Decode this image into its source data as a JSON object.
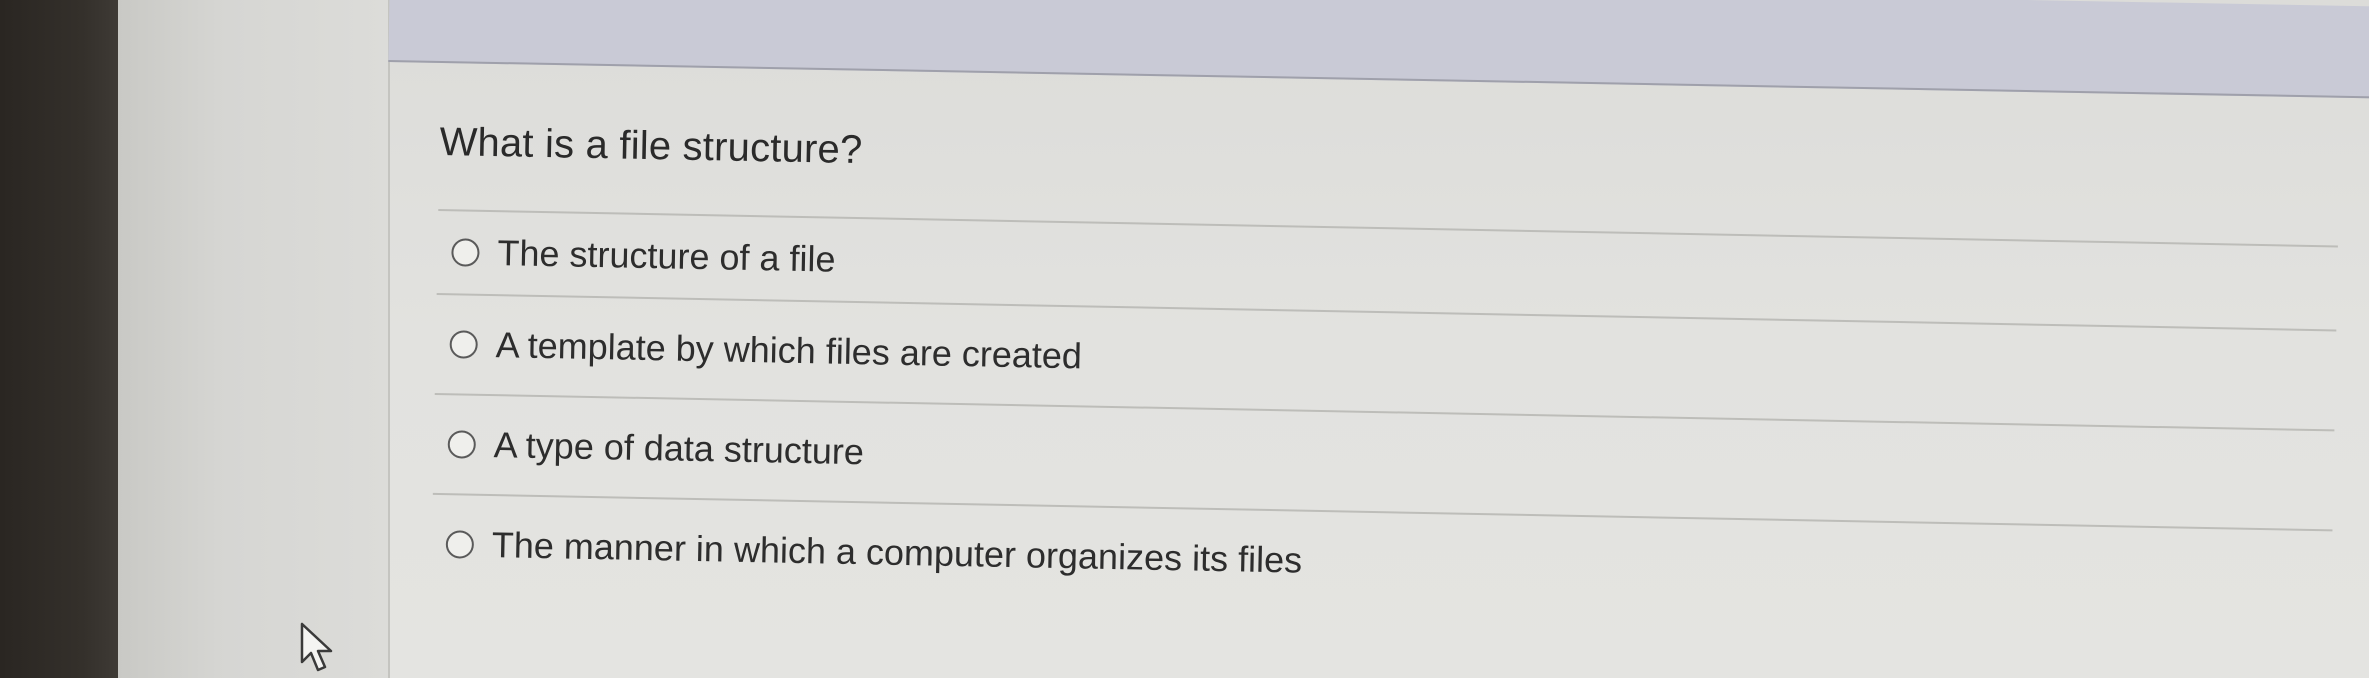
{
  "quiz": {
    "question": "What is a file structure?",
    "options": [
      {
        "label": "The structure of a file",
        "selected": false
      },
      {
        "label": "A template by which files are created",
        "selected": false
      },
      {
        "label": "A type of data structure",
        "selected": false
      },
      {
        "label": "The manner in which a computer organizes its files",
        "selected": false
      }
    ]
  },
  "icons": {
    "cursor": "mouse-pointer-icon",
    "radio": "radio-button-icon"
  },
  "colors": {
    "card_header": "#c9cad6",
    "page_background": "#e2e2df",
    "text": "#2a2a2a"
  }
}
